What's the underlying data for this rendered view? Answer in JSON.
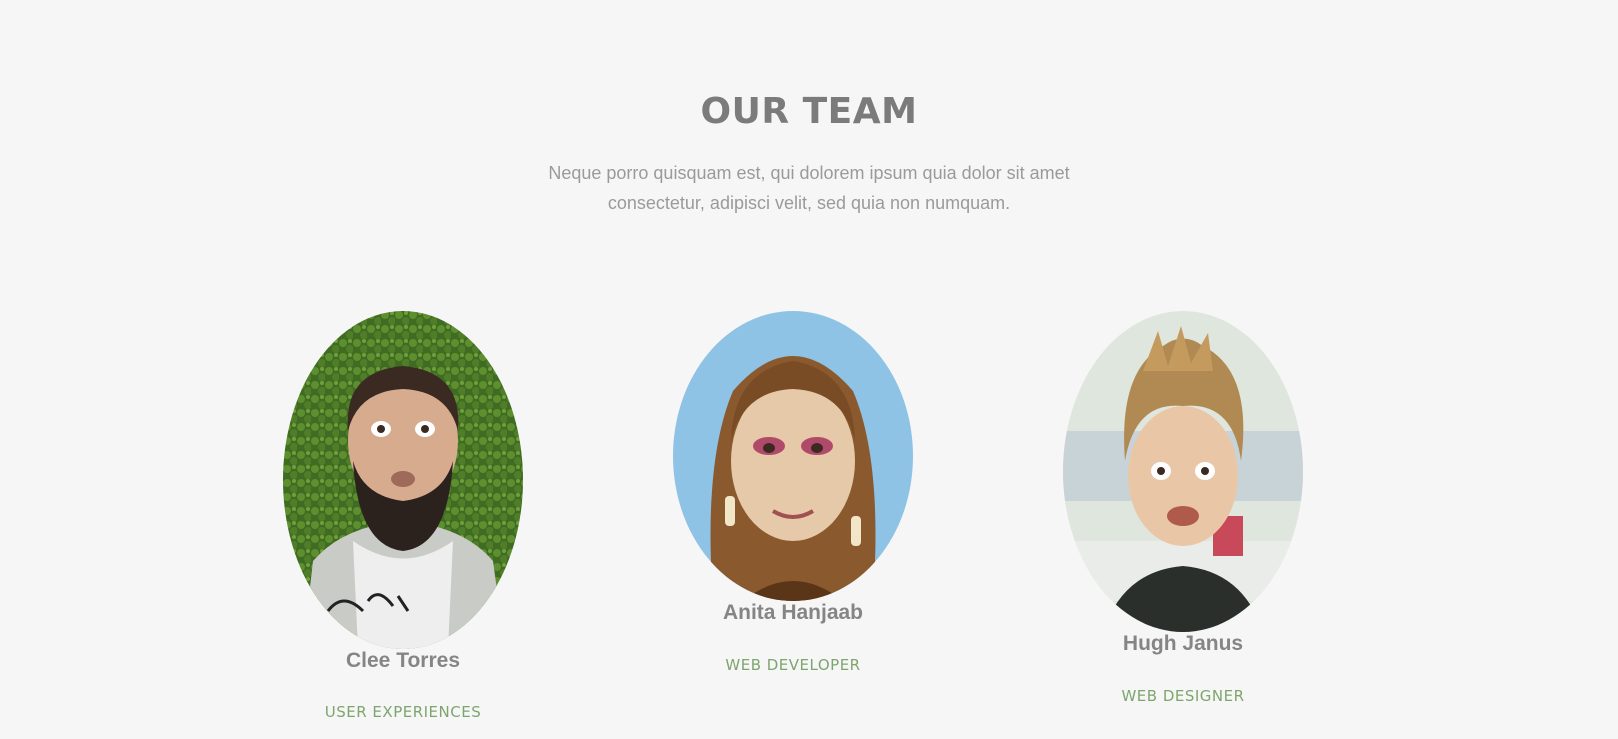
{
  "section": {
    "title": "OUR TEAM",
    "subtitle": "Neque porro quisquam est, qui dolorem ipsum quia dolor sit amet consectetur, adipisci velit, sed quia non numquam."
  },
  "team": [
    {
      "name": "Clee Torres",
      "role": "USER EXPERIENCES",
      "photo_description": "portrait-bearded-man-grey-hoodie"
    },
    {
      "name": "Anita Hanjaab",
      "role": "WEB DEVELOPER",
      "photo_description": "portrait-long-hair-earrings"
    },
    {
      "name": "Hugh Janus",
      "role": "WEB DESIGNER",
      "photo_description": "portrait-spiky-blond-hair"
    }
  ],
  "colors": {
    "background": "#f6f6f6",
    "title": "#7b7b7b",
    "subtitle": "#9a9a9a",
    "name": "#858585",
    "role": "#7ea56e"
  }
}
